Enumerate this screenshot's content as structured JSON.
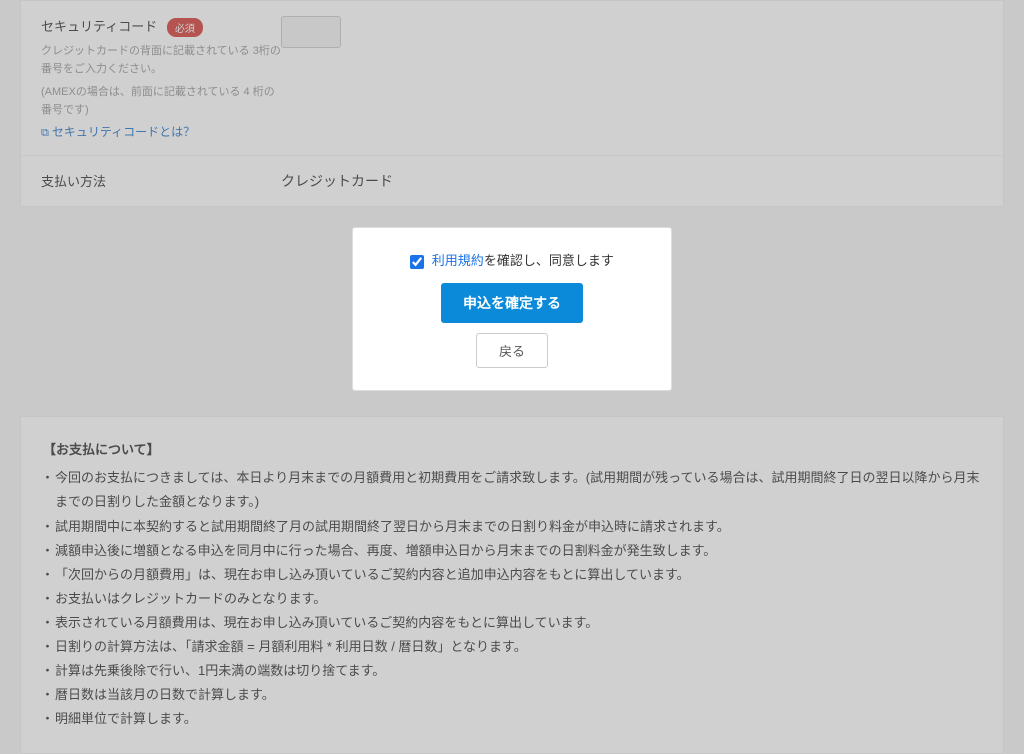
{
  "form": {
    "security_code": {
      "label": "セキュリティコード",
      "required_badge": "必須",
      "help1": "クレジットカードの背面に記載されている 3桁の番号をご入力ください。",
      "help2": "(AMEXの場合は、前面に記載されている 4 桁の番号です)",
      "link_text": "セキュリティコードとは？",
      "value": ""
    },
    "payment_method": {
      "label": "支払い方法",
      "value": "クレジットカード"
    }
  },
  "confirm": {
    "terms_link": "利用規約",
    "terms_suffix": "を確認し、同意します",
    "submit_button": "申込を確定する",
    "back_button": "戻る"
  },
  "footer": {
    "title": "【お支払について】",
    "items": [
      "今回のお支払につきましては、本日より月末までの月額費用と初期費用をご請求致します。(試用期間が残っている場合は、試用期間終了日の翌日以降から月末までの日割りした金額となります。)",
      "試用期間中に本契約すると試用期間終了月の試用期間終了翌日から月末までの日割り料金が申込時に請求されます。",
      "減額申込後に増額となる申込を同月中に行った場合、再度、増額申込日から月末までの日割料金が発生致します。",
      "「次回からの月額費用」は、現在お申し込み頂いているご契約内容と追加申込内容をもとに算出しています。",
      "お支払いはクレジットカードのみとなります。",
      "表示されている月額費用は、現在お申し込み頂いているご契約内容をもとに算出しています。",
      "日割りの計算方法は、「請求金額 = 月額利用料 * 利用日数 / 暦日数」となります。",
      "計算は先乗後除で行い、1円未満の端数は切り捨てます。",
      "暦日数は当該月の日数で計算します。",
      "明細単位で計算します。"
    ]
  }
}
